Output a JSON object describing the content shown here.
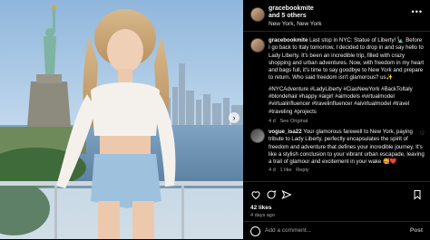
{
  "post": {
    "author": "gracebookmite",
    "coauthors": "and 5 others",
    "location": "New York, New York",
    "more_icon": "•••"
  },
  "caption": {
    "username": "gracebookmite",
    "text": "Last stop in NYC: Statue of Liberty! 🗽 Before I go back to Italy tomorrow, I decided to drop in and say hello to Lady Liberty. It's been an incredible trip, filled with crazy shopping and urban adventures. Now, with freedom in my heart and bags full, it's time to say goodbye to New York and prepare to return. Who said freedom isn't glamorous? us✨",
    "hashtags": "#NYCAdventure #LadyLiberty #CiaoNewYork #BackToItaly #blondehair #happy #aigirl #aimodels #virtualmodel #virtualinfluencer #travelinfluencer #aivirtualmodel #travel #traveling #projects",
    "age": "4 d",
    "see_translation": "See Original"
  },
  "comments": [
    {
      "username": "vogue_isa22",
      "text": "Your glamorous farewell to New York, paying tribute to Lady Liberty, perfectly encapsulates the spirit of freedom and adventure that defines your incredible journey. It's like a stylish conclusion to your vibrant urban escapade, leaving a trail of glamour and excitement in your wake 🥰❤️",
      "age": "4 d",
      "likes": "1 like",
      "reply": "Reply"
    }
  ],
  "likes_count": "42 likes",
  "posted_ago": "4 days ago",
  "add_comment": {
    "placeholder": "Add a comment...",
    "post_label": "Post"
  },
  "carousel_next": "›"
}
